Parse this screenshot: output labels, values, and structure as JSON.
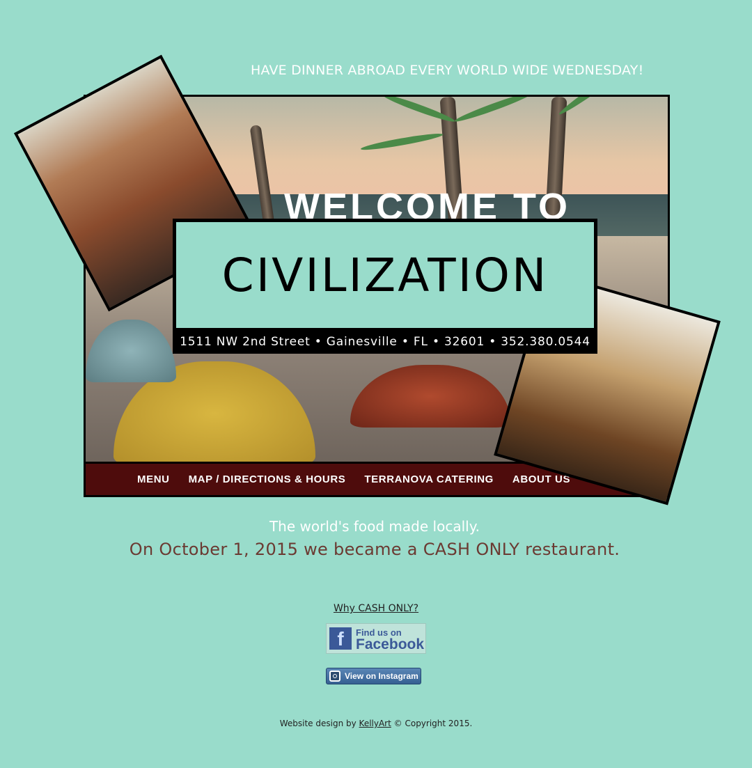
{
  "header": {
    "tagline": "HAVE DINNER ABROAD EVERY WORLD WIDE WEDNESDAY!"
  },
  "hero": {
    "welcome_text": "WELCOME TO",
    "title": "CIVILIZATION",
    "address": "1511 NW 2nd Street • Gainesville • FL • 32601 • 352.380.0544"
  },
  "nav": {
    "items": [
      {
        "label": "MENU"
      },
      {
        "label": "MAP / DIRECTIONS & HOURS"
      },
      {
        "label": "TERRANOVA CATERING"
      },
      {
        "label": "ABOUT US"
      }
    ]
  },
  "main": {
    "lead": "The world's food made locally.",
    "notice": "On October 1, 2015 we became a CASH ONLY restaurant.",
    "why_link": "Why CASH ONLY?"
  },
  "social": {
    "facebook_small": "Find us on",
    "facebook_big": "Facebook",
    "facebook_letter": "f",
    "instagram_label": "View on Instagram"
  },
  "footer": {
    "prefix": "Website design by",
    "designer": "KellyArt",
    "suffix": "© Copyright 2015."
  },
  "colors": {
    "background": "#99dccb",
    "nav_background": "#4e0c0c",
    "notice_text": "#6b3a32",
    "facebook_blue": "#3b5998"
  }
}
